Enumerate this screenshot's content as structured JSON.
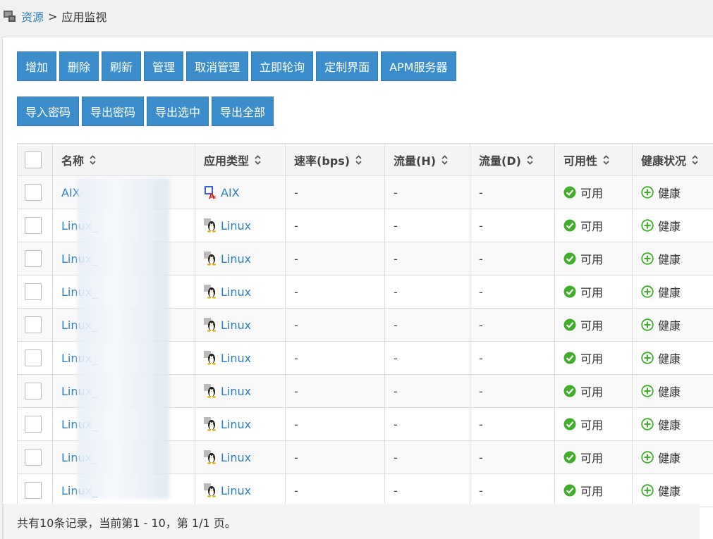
{
  "breadcrumb": {
    "root": "资源",
    "separator": ">",
    "current": "应用监视"
  },
  "toolbar": {
    "row1": [
      "增加",
      "删除",
      "刷新",
      "管理",
      "取消管理",
      "立即轮询",
      "定制界面",
      "APM服务器"
    ],
    "row2": [
      "导入密码",
      "导出密码",
      "导出选中",
      "导出全部"
    ]
  },
  "table": {
    "columns": [
      "名称",
      "应用类型",
      "速率(bps)",
      "流量(H)",
      "流量(D)",
      "可用性",
      "健康状况"
    ],
    "rows": [
      {
        "name": "AIX",
        "type": "AIX",
        "type_icon": "aix-icon",
        "rate": "-",
        "flow_h": "-",
        "flow_d": "-",
        "availability": "可用",
        "health": "健康"
      },
      {
        "name": "Linux_",
        "type": "Linux",
        "type_icon": "linux-penguin-icon",
        "rate": "-",
        "flow_h": "-",
        "flow_d": "-",
        "availability": "可用",
        "health": "健康"
      },
      {
        "name": "Linux_",
        "type": "Linux",
        "type_icon": "linux-penguin-icon",
        "rate": "-",
        "flow_h": "-",
        "flow_d": "-",
        "availability": "可用",
        "health": "健康"
      },
      {
        "name": "Linux_",
        "type": "Linux",
        "type_icon": "linux-penguin-icon",
        "rate": "-",
        "flow_h": "-",
        "flow_d": "-",
        "availability": "可用",
        "health": "健康"
      },
      {
        "name": "Linux_",
        "type": "Linux",
        "type_icon": "linux-penguin-icon",
        "rate": "-",
        "flow_h": "-",
        "flow_d": "-",
        "availability": "可用",
        "health": "健康"
      },
      {
        "name": "Linux_",
        "type": "Linux",
        "type_icon": "linux-penguin-icon",
        "rate": "-",
        "flow_h": "-",
        "flow_d": "-",
        "availability": "可用",
        "health": "健康"
      },
      {
        "name": "Linux_",
        "type": "Linux",
        "type_icon": "linux-penguin-icon",
        "rate": "-",
        "flow_h": "-",
        "flow_d": "-",
        "availability": "可用",
        "health": "健康"
      },
      {
        "name": "Linux_",
        "type": "Linux",
        "type_icon": "linux-penguin-icon",
        "rate": "-",
        "flow_h": "-",
        "flow_d": "-",
        "availability": "可用",
        "health": "健康"
      },
      {
        "name": "Linux_",
        "type": "Linux",
        "type_icon": "linux-penguin-icon",
        "rate": "-",
        "flow_h": "-",
        "flow_d": "-",
        "availability": "可用",
        "health": "健康"
      },
      {
        "name": "Linux_",
        "type": "Linux",
        "type_icon": "linux-penguin-icon",
        "rate": "-",
        "flow_h": "-",
        "flow_d": "-",
        "availability": "可用",
        "health": "健康"
      }
    ]
  },
  "footer": {
    "summary": "共有10条记录，当前第1 - 10，第 1/1 页。"
  },
  "colors": {
    "button": "#3c8dcb",
    "link": "#2b80c4",
    "ok_green": "#3fae29"
  }
}
